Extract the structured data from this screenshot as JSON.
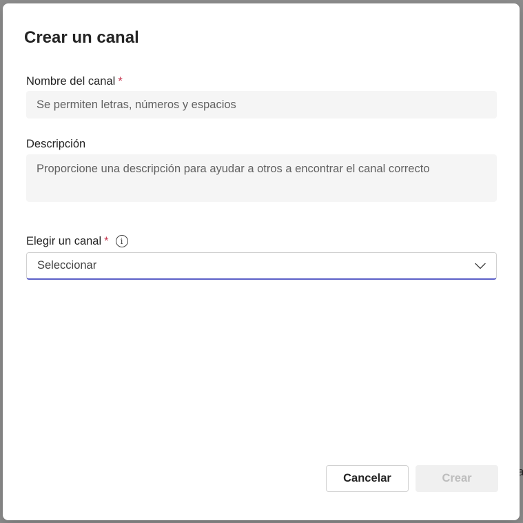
{
  "dialog": {
    "title": "Crear un canal",
    "fields": {
      "name": {
        "label": "Nombre del canal",
        "required_mark": "*",
        "value": "",
        "placeholder": "Se permiten letras, números y espacios"
      },
      "description": {
        "label": "Descripción",
        "value": "",
        "placeholder": "Proporcione una descripción para ayudar a otros a encontrar el canal correcto"
      },
      "channel": {
        "label": "Elegir un canal",
        "required_mark": "*",
        "info_glyph": "i",
        "selected_value": "Seleccionar"
      }
    },
    "buttons": {
      "cancel": "Cancelar",
      "create": "Crear"
    }
  },
  "background": {
    "partial_text": "a"
  },
  "colors": {
    "required": "#c4314b",
    "accent": "#5b5fc7",
    "input_bg": "#f5f5f5",
    "disabled_text": "#bdbdbd"
  },
  "icons": {
    "info": "info-icon",
    "dropdown": "chevron-down-icon"
  }
}
